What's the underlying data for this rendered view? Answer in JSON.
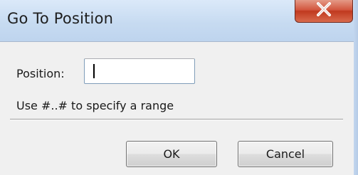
{
  "dialog": {
    "title": "Go To Position",
    "position_label": "Position:",
    "position_value": "",
    "hint": "Use #..# to specify a range",
    "ok_label": "OK",
    "cancel_label": "Cancel"
  },
  "icons": {
    "close": "close-icon"
  },
  "colors": {
    "titlebar": "#c7dbf1",
    "close_button": "#c0391f",
    "client_background": "#f0f0f0"
  }
}
